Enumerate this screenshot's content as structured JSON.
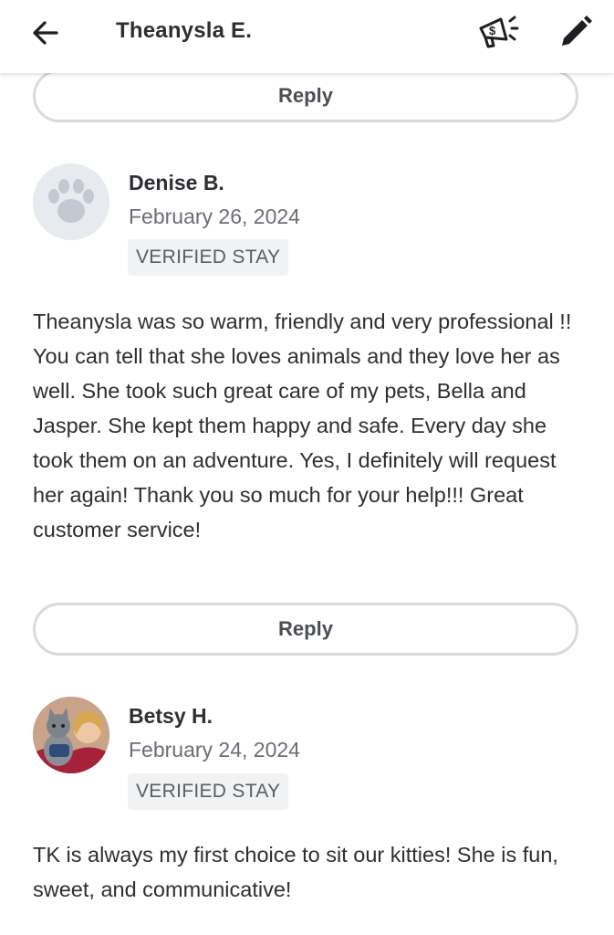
{
  "header": {
    "title": "Theanysla E.",
    "back_icon": "arrow-left-icon",
    "promote_icon": "megaphone-dollar-icon",
    "edit_icon": "pencil-icon"
  },
  "reply_label": "Reply",
  "reviews": [
    {
      "name": "Denise B.",
      "date": "February 26, 2024",
      "badge": "VERIFIED STAY",
      "avatar": "paw-placeholder-icon",
      "text": "Theanysla was so warm, friendly and very professional !! You can tell that she loves animals and they love her as well. She took such great care of my pets, Bella and Jasper. She kept them happy and safe. Every day she took them on an adventure. Yes, I definitely  will request her again! Thank you so much for your help!!!  Great customer service!"
    },
    {
      "name": "Betsy H.",
      "date": "February 24, 2024",
      "badge": "VERIFIED STAY",
      "avatar": "user-photo-with-cat",
      "text": "TK is always my first choice to sit our kitties! She is fun, sweet, and communicative!"
    }
  ],
  "colors": {
    "text": "#2e2e33",
    "muted": "#6b6e76",
    "border": "#d7dae0",
    "badge_bg": "#f1f2f4"
  }
}
